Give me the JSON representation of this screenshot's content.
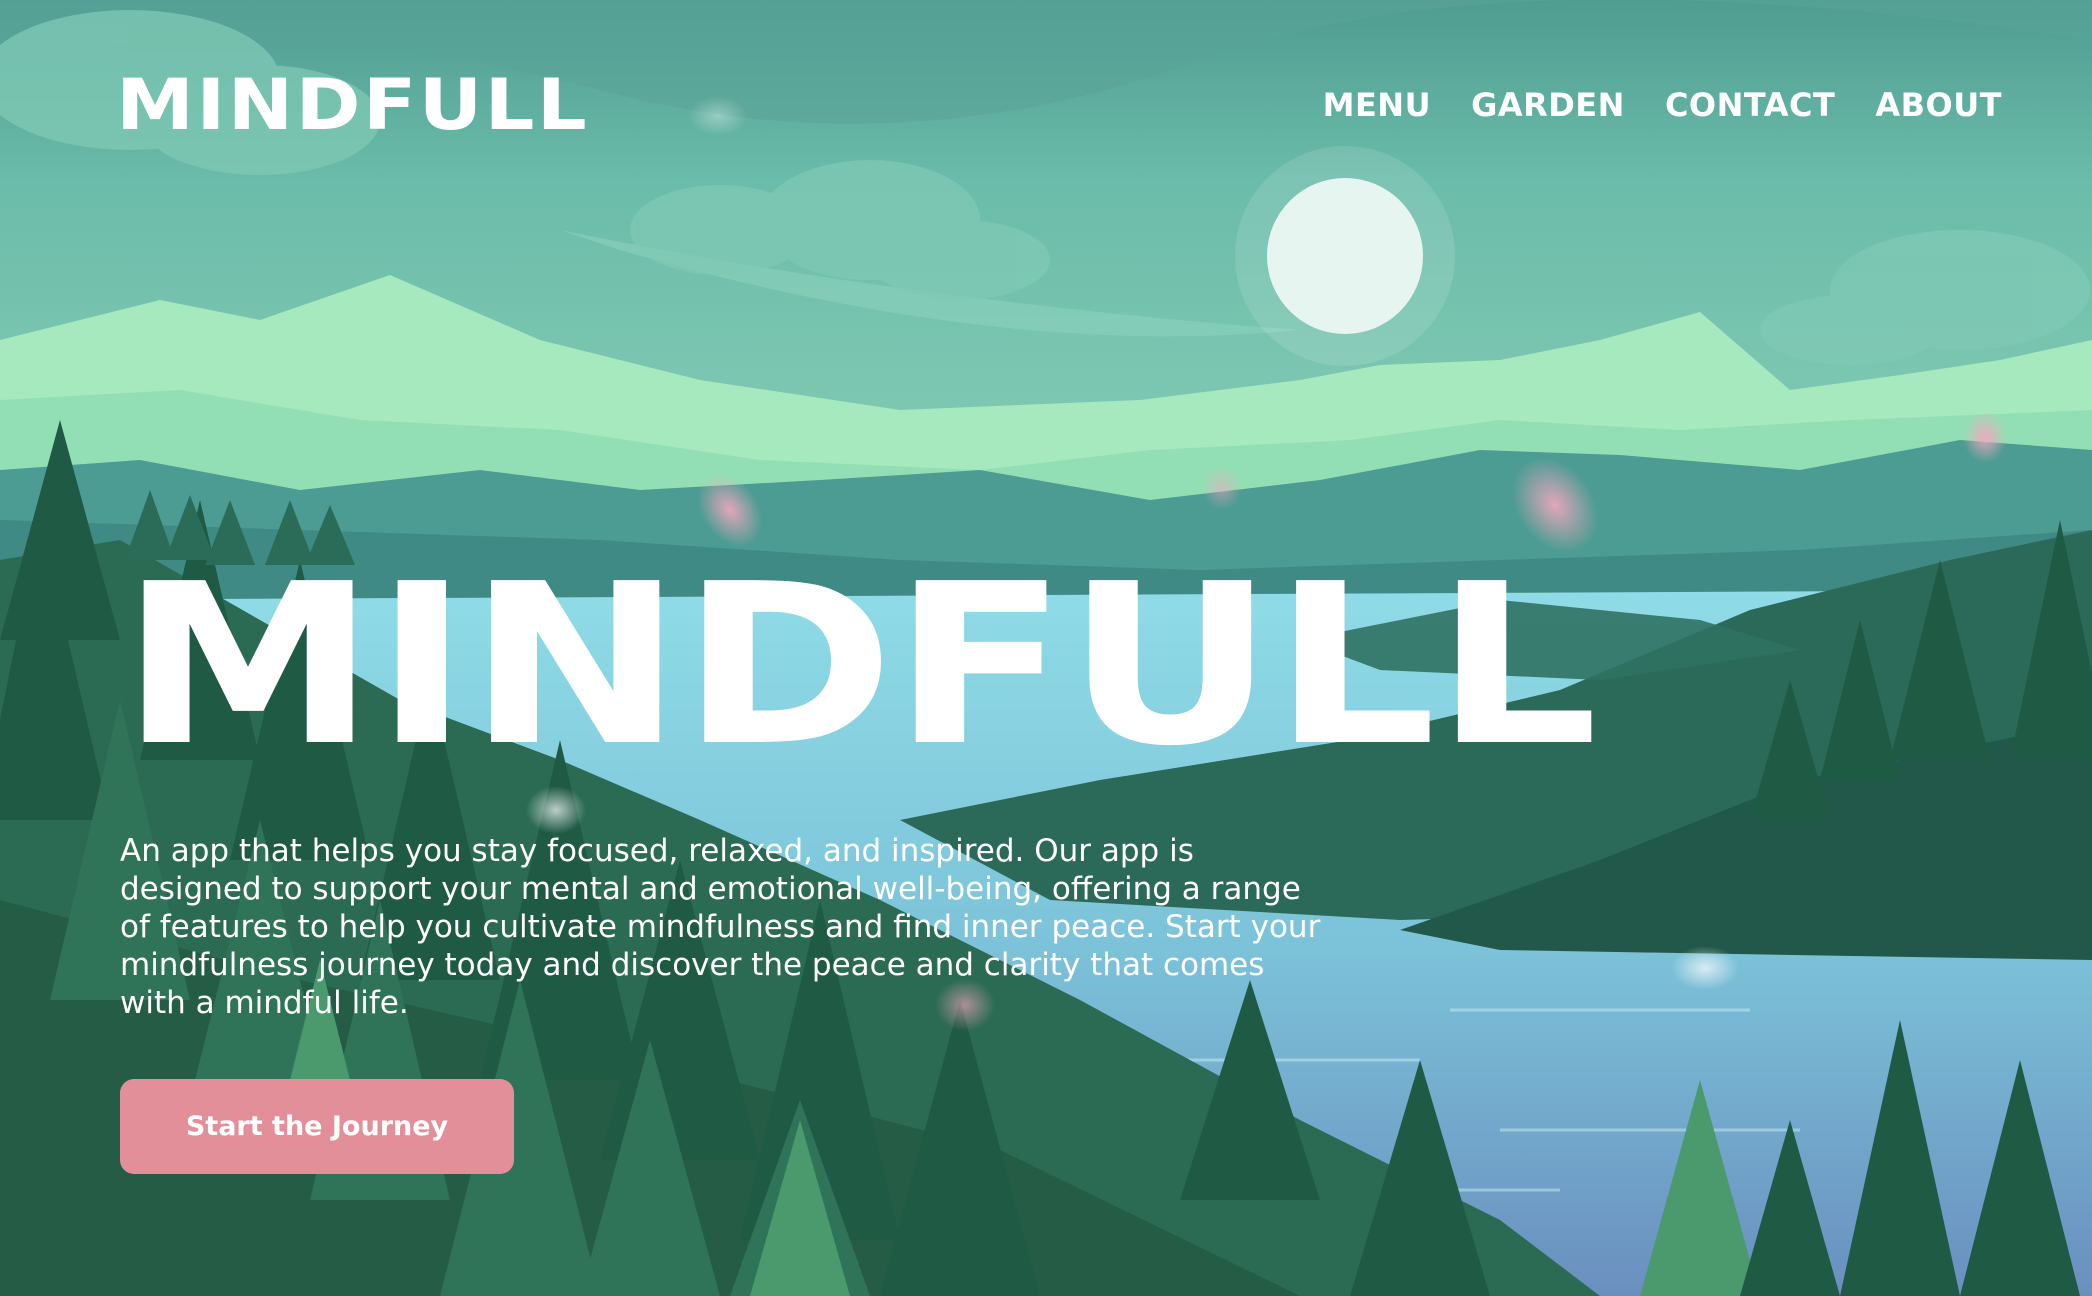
{
  "brand": {
    "logo_text": "MINDFULL"
  },
  "nav": {
    "items": [
      {
        "label": "MENU"
      },
      {
        "label": "GARDEN"
      },
      {
        "label": "CONTACT"
      },
      {
        "label": "ABOUT"
      }
    ]
  },
  "hero": {
    "title": "MINDFULL",
    "description": "An app that helps you stay focused, relaxed, and inspired. Our app is designed to support your mental and emotional well-being, offering a range of features to help you cultivate mindfulness and find inner peace. Start your mindfulness journey today and discover the peace and clarity that comes with a mindful life.",
    "cta_label": "Start the Journey"
  },
  "colors": {
    "sky": "#5aa89b",
    "mountain_light": "#a6e9bf",
    "lake": "#7fd0df",
    "forest_dark": "#1f5c4a",
    "cta": "#e38f9a",
    "text": "#ffffff"
  }
}
